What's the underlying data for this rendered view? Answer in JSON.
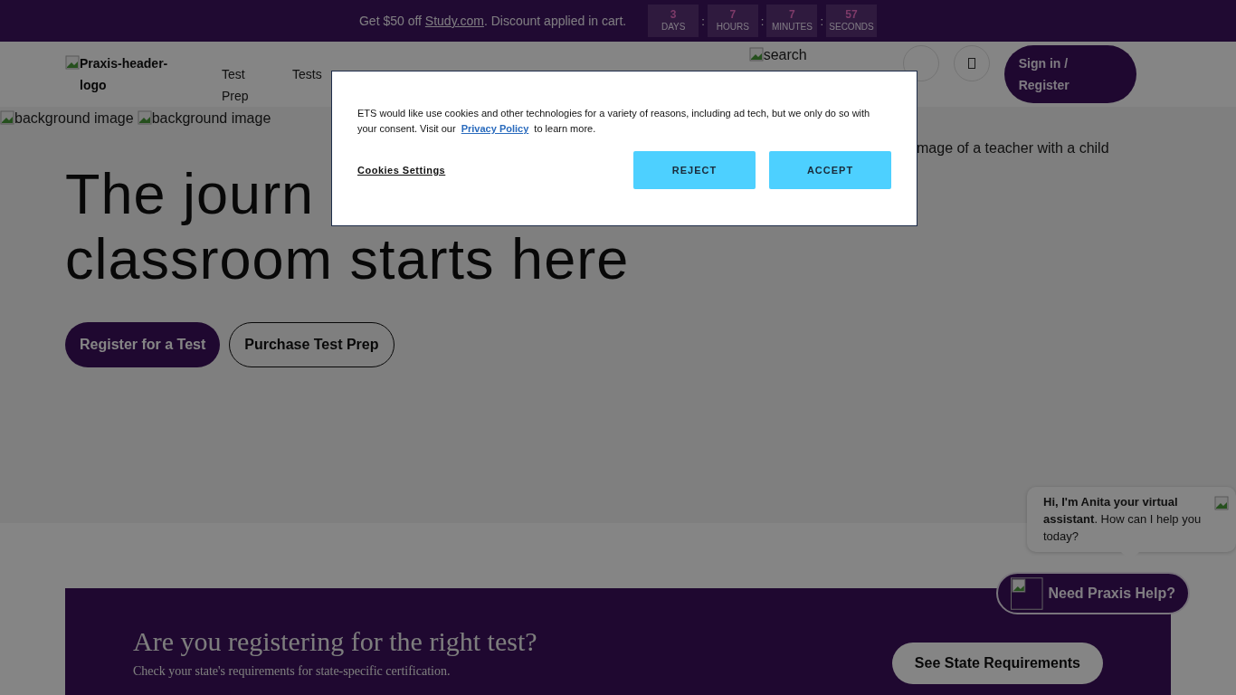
{
  "promo_bar": {
    "text_before": "Get $50 off ",
    "link": "Study.com",
    "text_after": ". Discount applied in cart.",
    "separator": ":",
    "countdown": [
      {
        "value": "3",
        "unit": "DAYS"
      },
      {
        "value": "7",
        "unit": "HOURS"
      },
      {
        "value": "7",
        "unit": "MINUTES"
      },
      {
        "value": "57",
        "unit": "SECONDS"
      }
    ]
  },
  "header": {
    "logo_alt": "Praxis-header-logo",
    "nav": [
      "Test Prep",
      "Tests"
    ],
    "search_alt": "search",
    "sign_in": "Sign in / Register"
  },
  "background_images": [
    "background image",
    "background image"
  ],
  "hero": {
    "heading_lines": [
      "The journ",
      "classroom starts here"
    ],
    "image_alt": "mage of a teacher with a child",
    "buttons": [
      {
        "label": "Register for a Test",
        "kind": "primary"
      },
      {
        "label": "Purchase Test Prep",
        "kind": "outline"
      }
    ]
  },
  "state_banner": {
    "title": "Are you registering for the right test?",
    "subtitle": "Check your state's requirements for state-specific certification.",
    "button": "See State Requirements"
  },
  "chat": {
    "message": "**Hi, I'm Anita your virtual assistant**. How can I help you today?",
    "launcher": "Need Praxis Help?"
  },
  "cookie_banner": {
    "text_before": "ETS would like use cookies and other technologies for a variety of reasons, including ad tech, but we only do so with your consent. Visit our ",
    "link": "Privacy Policy",
    "text_after": " to learn more.",
    "settings_link": "Cookies Settings",
    "buttons": [
      "REJECT",
      "ACCEPT"
    ]
  }
}
